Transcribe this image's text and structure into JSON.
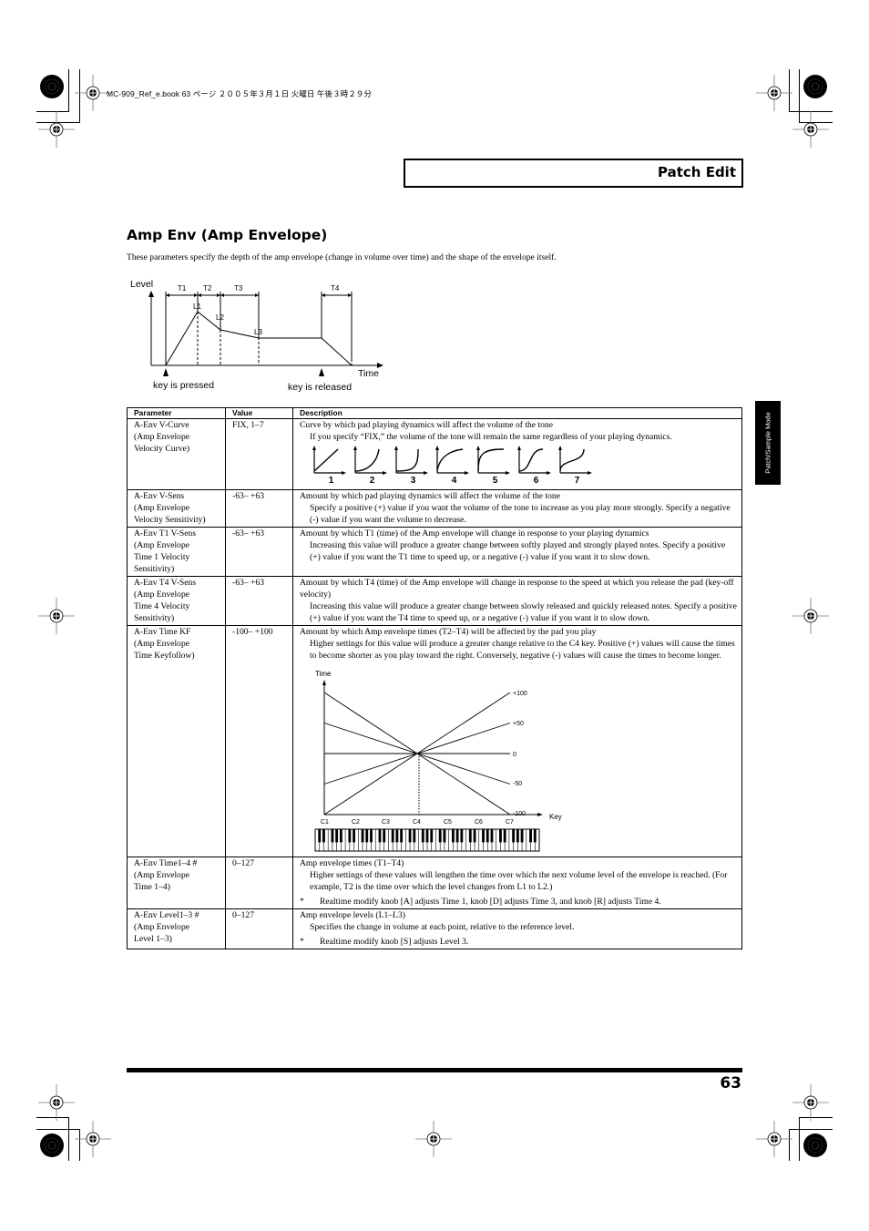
{
  "print_header": "MC-909_Ref_e.book  63 ページ  ２００５年３月１日  火曜日  午後３時２９分",
  "header": {
    "title": "Patch Edit"
  },
  "side_tab": {
    "label": "Patch/Sample Mode"
  },
  "section": {
    "title": "Amp Env (Amp Envelope)",
    "intro": "These parameters specify the depth of the amp envelope (change in volume over time) and the shape of the envelope itself."
  },
  "envelope_diagram": {
    "y_label": "Level",
    "x_label": "Time",
    "time_labels": [
      "T1",
      "T2",
      "T3",
      "T4"
    ],
    "level_labels": [
      "L1",
      "L2",
      "L3"
    ],
    "key_pressed": "key is pressed",
    "key_released": "key is released"
  },
  "table": {
    "headers": [
      "Parameter",
      "Value",
      "Description"
    ],
    "rows": [
      {
        "param": [
          "A-Env V-Curve",
          "(Amp Envelope",
          "Velocity Curve)"
        ],
        "value": "FIX, 1–7",
        "desc_main": "Curve by which pad playing dynamics will affect the volume of the tone",
        "desc_sub": "If you specify “FIX,” the volume of the tone will remain the same regardless of your playing dynamics.",
        "curves": [
          "1",
          "2",
          "3",
          "4",
          "5",
          "6",
          "7"
        ]
      },
      {
        "param": [
          "A-Env V-Sens",
          "(Amp Envelope",
          "Velocity Sensitivity)"
        ],
        "value": "-63– +63",
        "desc_main": "Amount by which pad playing dynamics will affect the volume of the tone",
        "desc_sub": "Specify a positive (+) value if you want the volume of the tone to increase as you play more strongly. Specify a negative (-) value if you want the volume to decrease."
      },
      {
        "param": [
          "A-Env T1 V-Sens",
          "(Amp Envelope",
          "Time 1 Velocity",
          "Sensitivity)"
        ],
        "value": "-63– +63",
        "desc_main": "Amount by which T1 (time) of the Amp envelope will change in response to your playing dynamics",
        "desc_sub": "Increasing this value will produce a greater change between softly played and strongly played notes. Specify a positive (+) value if you want the T1 time to speed up, or a negative (-) value if you want it to slow down."
      },
      {
        "param": [
          "A-Env T4 V-Sens",
          "(Amp Envelope",
          "Time 4 Velocity",
          "Sensitivity)"
        ],
        "value": "-63– +63",
        "desc_main": "Amount by which T4 (time) of the Amp envelope will change in response to the speed at which you release the pad (key-off velocity)",
        "desc_sub": "Increasing this value will produce a greater change between slowly released and quickly released notes. Specify a positive (+) value if you want the T4 time to speed up, or a negative (-) value if you want it to slow down."
      },
      {
        "param": [
          "A-Env Time KF",
          "(Amp Envelope",
          "Time Keyfollow)"
        ],
        "value": "-100– +100",
        "desc_main": "Amount by which Amp envelope times (T2–T4) will be affected by the pad you play",
        "desc_sub": "Higher settings for this value will produce a greater change relative to the C4 key. Positive (+) values will cause the times to become shorter as you play toward the right. Conversely, negative (-) values will cause the times to become longer."
      },
      {
        "param": [
          "A-Env Time1–4 #",
          "(Amp Envelope",
          "Time 1–4)"
        ],
        "value": "0–127",
        "desc_main": "Amp envelope times (T1–T4)",
        "desc_sub": "Higher settings of these values will lengthen the time over which the next volume level of the envelope is reached. (For example, T2 is the time over which the level changes from L1 to L2.)",
        "note": "Realtime modify knob [A] adjusts Time 1, knob [D] adjusts Time 3, and knob [R] adjusts Time 4."
      },
      {
        "param": [
          "A-Env Level1–3 #",
          "(Amp Envelope",
          "Level 1–3)"
        ],
        "value": "0–127",
        "desc_main": "Amp envelope levels (L1–L3)",
        "desc_sub": "Specifies the change in volume at each point, relative to the reference level.",
        "note": "Realtime modify knob [S] adjusts Level 3."
      }
    ]
  },
  "keyfollow_chart": {
    "y_label": "Time",
    "x_label": "Key",
    "x_ticks": [
      "C1",
      "C2",
      "C3",
      "C4",
      "C5",
      "C6",
      "C7"
    ],
    "series_labels": [
      "+100",
      "+50",
      "0",
      "-50",
      "-100"
    ]
  },
  "note_marker": "*",
  "page_number": "63"
}
